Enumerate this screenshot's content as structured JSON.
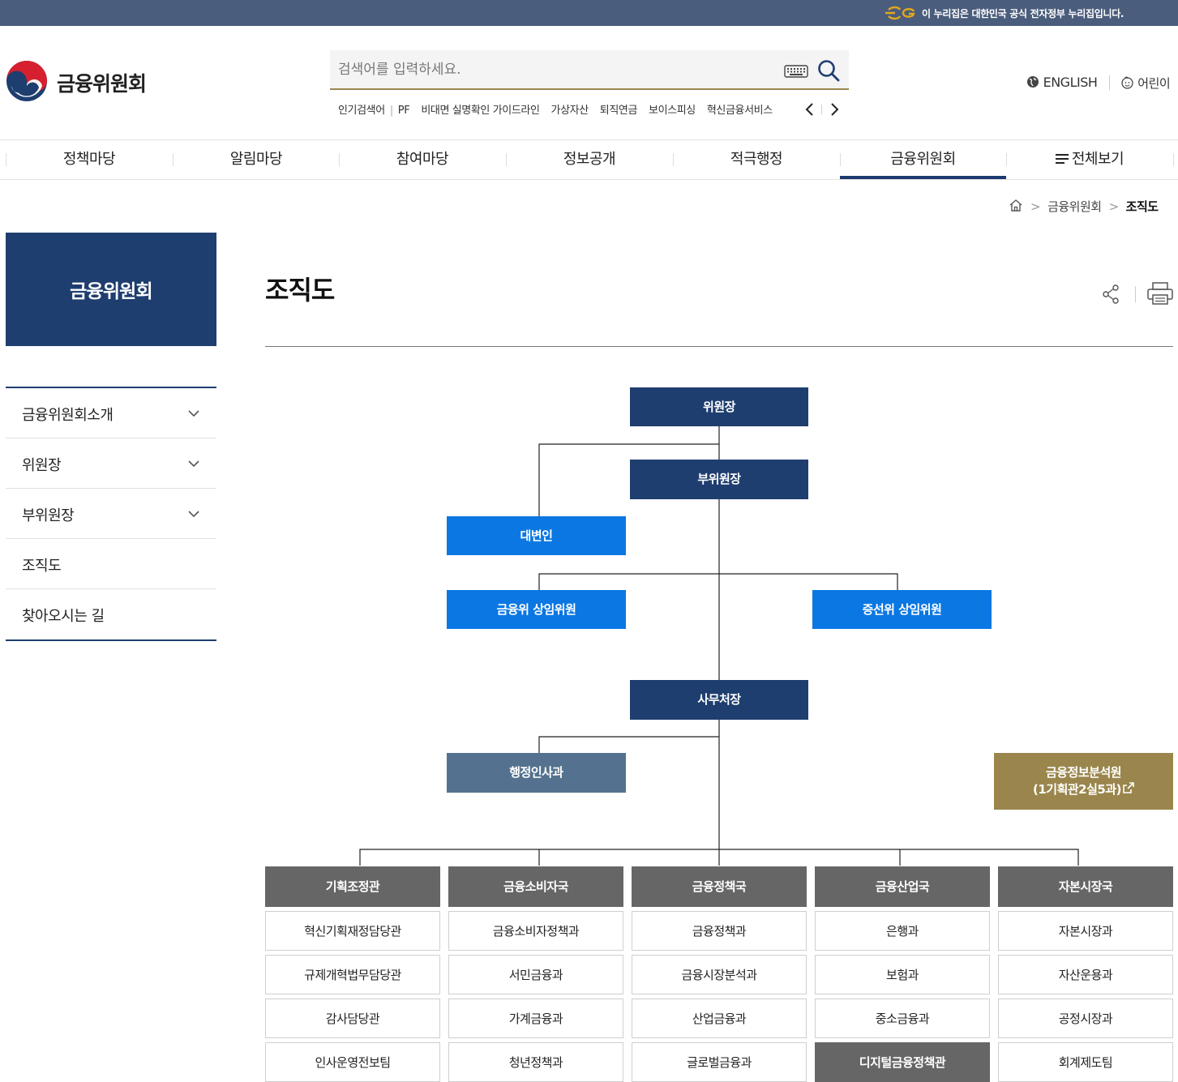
{
  "topbar": {
    "notice": "이 누리집은 대한민국 공식 전자정부 누리집입니다."
  },
  "header": {
    "logo_text": "금융위원회",
    "search_placeholder": "검색어를 입력하세요.",
    "popular_label": "인기검색어",
    "popular_terms": [
      "PF",
      "비대면 실명확인 가이드라인",
      "가상자산",
      "퇴직연금",
      "보이스피싱",
      "혁신금융서비스"
    ],
    "english": "ENGLISH",
    "kids": "어린이"
  },
  "gnb": [
    "정책마당",
    "알림마당",
    "참여마당",
    "정보공개",
    "적극행정",
    "금융위원회",
    "전체보기"
  ],
  "breadcrumb": {
    "parent": "금융위원회",
    "current": "조직도"
  },
  "sidebar": {
    "title": "금융위원회",
    "items": [
      {
        "label": "금융위원회소개",
        "expandable": true
      },
      {
        "label": "위원장",
        "expandable": true
      },
      {
        "label": "부위원장",
        "expandable": true
      },
      {
        "label": "조직도",
        "expandable": false
      },
      {
        "label": "찾아오시는 길",
        "expandable": false
      }
    ]
  },
  "page": {
    "title": "조직도"
  },
  "org": {
    "chairman": "위원장",
    "vice_chairman": "부위원장",
    "spokesperson": "대변인",
    "fsc_commissioner": "금융위 상임위원",
    "sfc_commissioner": "증선위 상임위원",
    "secretary_general": "사무처장",
    "admin_personnel": "행정인사과",
    "fiu_line1": "금융정보분석원",
    "fiu_line2": "(1기획관2실5과)",
    "bureaus": [
      {
        "name": "기획조정관",
        "divisions": [
          "혁신기획재정담당관",
          "규제개혁법무담당관",
          "감사담당관",
          "인사운영전보팀"
        ]
      },
      {
        "name": "금융소비자국",
        "divisions": [
          "금융소비자정책과",
          "서민금융과",
          "가계금융과",
          "청년정책과"
        ]
      },
      {
        "name": "금융정책국",
        "divisions": [
          "금융정책과",
          "금융시장분석과",
          "산업금융과",
          "글로벌금융과"
        ]
      },
      {
        "name": "금융산업국",
        "divisions": [
          "은행과",
          "보험과",
          "중소금융과",
          "디지털금융정책관"
        ]
      },
      {
        "name": "자본시장국",
        "divisions": [
          "자본시장과",
          "자산운용과",
          "공정시장과",
          "회계제도팀"
        ]
      }
    ]
  },
  "colors": {
    "navy": "#1e3e6f",
    "blue": "#0b77e3",
    "slate": "#54728f",
    "gold": "#9a864c",
    "grey": "#666666",
    "topbar": "#4b5d7c"
  }
}
